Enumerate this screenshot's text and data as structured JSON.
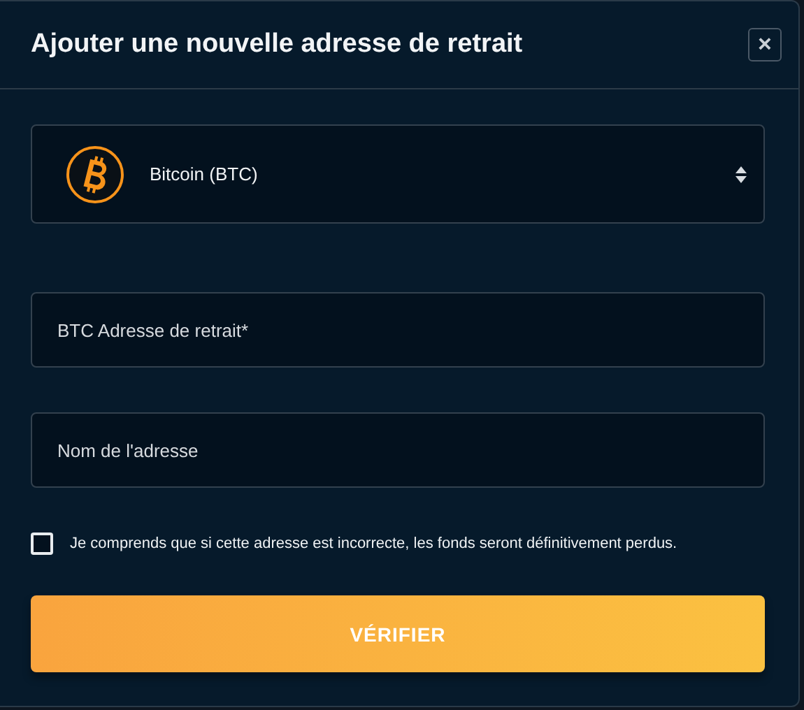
{
  "dialog": {
    "title": "Ajouter une nouvelle adresse de retrait",
    "close": "×"
  },
  "currency_select": {
    "value": "Bitcoin (BTC)"
  },
  "fields": [
    {
      "placeholder": "BTC Adresse de retrait*"
    },
    {
      "placeholder": "Nom de l'adresse"
    }
  ],
  "agreement": {
    "label": "Je comprends que si cette adresse est incorrecte, les fonds seront définitivement perdus.",
    "checked": false
  },
  "submit": {
    "label": "VÉRIFIER"
  }
}
